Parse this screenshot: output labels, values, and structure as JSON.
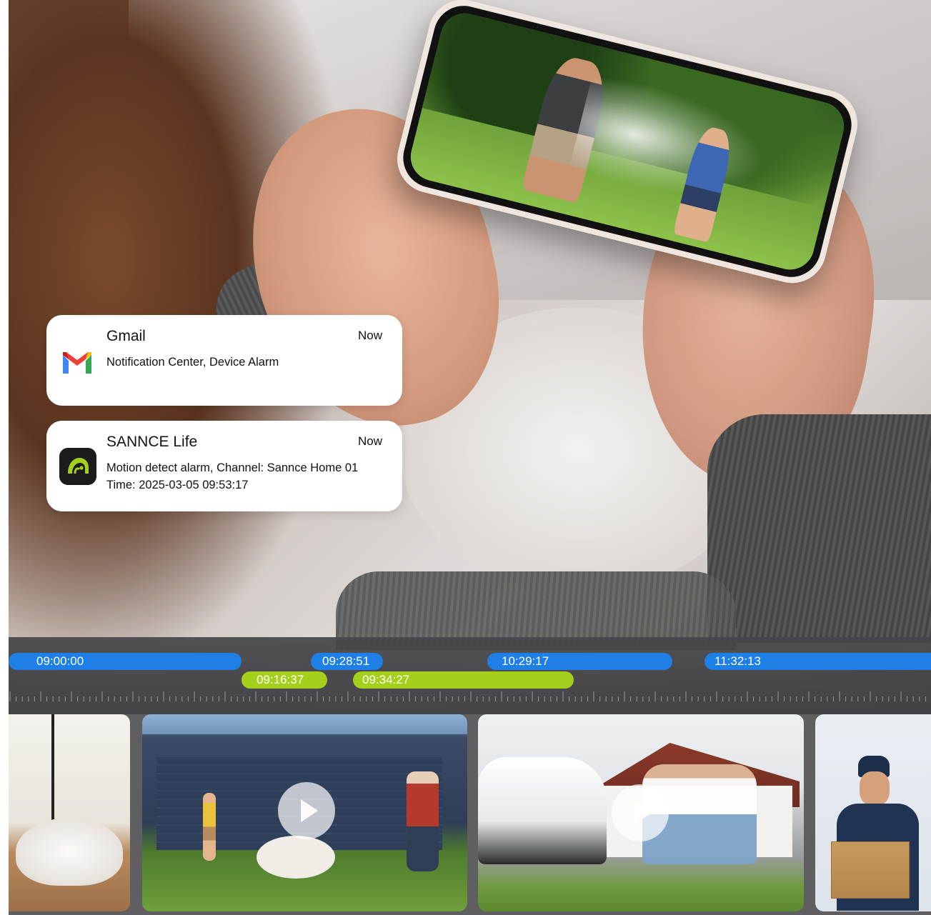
{
  "notifications": [
    {
      "app": "Gmail",
      "time": "Now",
      "lines": [
        "Notification Center, Device Alarm"
      ],
      "icon": "gmail-icon"
    },
    {
      "app": "SANNCE Life",
      "time": "Now",
      "lines": [
        "Motion detect alarm, Channel: Sannce Home 01",
        "Time: 2025-03-05  09:53:17"
      ],
      "icon": "sannce-life-icon"
    }
  ],
  "timeline": {
    "blue_segments": [
      "09:00:00",
      "09:28:51",
      "10:29:17",
      "11:32:13"
    ],
    "green_segments": [
      "09:16:37",
      "09:34:27"
    ],
    "colors": {
      "blue": "#1e7fe6",
      "green": "#a4cf1a"
    }
  },
  "thumbnails": [
    "cat-clip",
    "dog-clip",
    "family-car-clip",
    "delivery-clip"
  ]
}
